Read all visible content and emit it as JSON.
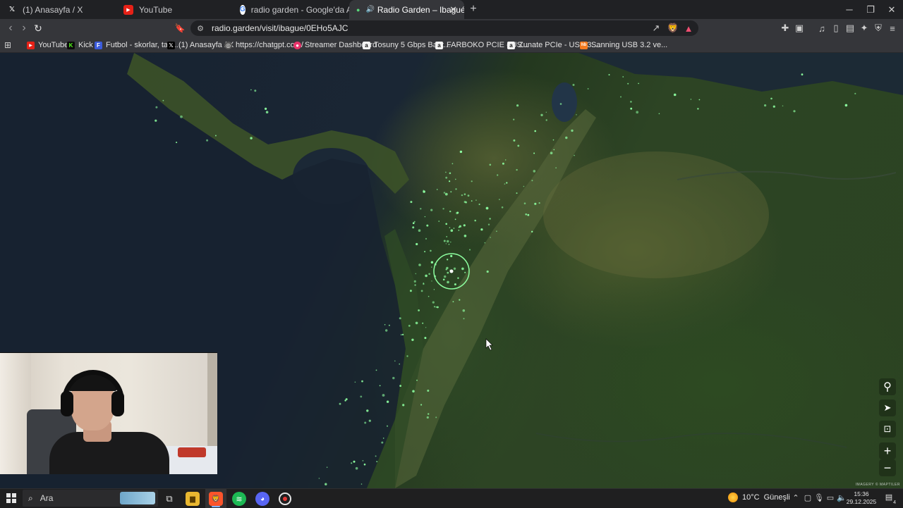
{
  "browser": {
    "tabs": [
      {
        "label": "(1) Anasayfa / X",
        "icon": "x-logo-icon",
        "active": false
      },
      {
        "label": "YouTube",
        "icon": "youtube-icon",
        "active": false
      },
      {
        "label": "radio garden - Google'da Ara",
        "icon": "google-icon",
        "active": false
      },
      {
        "label": "Radio Garden – Ibagué",
        "icon": "radio-garden-icon",
        "active": true,
        "close": "✕"
      }
    ],
    "new_tab": "+",
    "window_controls": {
      "minimize": "─",
      "restore": "❐",
      "close": "✕"
    },
    "address": {
      "url": "radio.garden/visit/ibague/0EHo5AJC"
    }
  },
  "bookmarks": [
    {
      "label": "YouTube",
      "icon": "youtube-icon",
      "color": "#e62117"
    },
    {
      "label": "Kick",
      "icon": "kick-icon",
      "color": "#53fc18"
    },
    {
      "label": "Futbol - skorlar, tak...",
      "icon": "futbol-icon",
      "color": "#3b5bdb"
    },
    {
      "label": "(1) Anasayfa / X",
      "icon": "x-logo-icon",
      "color": "#000000"
    },
    {
      "label": "https://chatgpt.com/",
      "icon": "chatgpt-icon",
      "color": "#777777"
    },
    {
      "label": "Streamer Dashboard",
      "icon": "streamer-icon",
      "color": "#e8336a"
    },
    {
      "label": "Tosuny 5 Gbps Bant...",
      "icon": "amazon-icon",
      "color": "#f3f3f3"
    },
    {
      "label": "FARBOKO PCIE - US...",
      "icon": "amazon-icon",
      "color": "#f3f3f3"
    },
    {
      "label": "Zunate PCIe - USB 3....",
      "icon": "amazon-icon",
      "color": "#f3f3f3"
    },
    {
      "label": "Sanning USB 3.2 ve...",
      "icon": "hb-icon",
      "color": "#f47b20"
    }
  ],
  "map": {
    "accent": "#8dffa0",
    "controls": [
      {
        "name": "explore-icon",
        "glyph": "🎈"
      },
      {
        "name": "locate-icon",
        "glyph": "➤"
      },
      {
        "name": "lock-icon",
        "glyph": "🔒"
      },
      {
        "name": "zoom-in-icon",
        "glyph": "+"
      },
      {
        "name": "zoom-out-icon",
        "glyph": "−"
      }
    ],
    "attribution": "IMAGERY © MAPTILER"
  },
  "taskbar": {
    "search_placeholder": "Ara",
    "weather": {
      "temp": "10°C",
      "condition": "Güneşli"
    },
    "clock": {
      "time": "15:36",
      "date": "29.12.2025"
    },
    "notifications": "4"
  }
}
